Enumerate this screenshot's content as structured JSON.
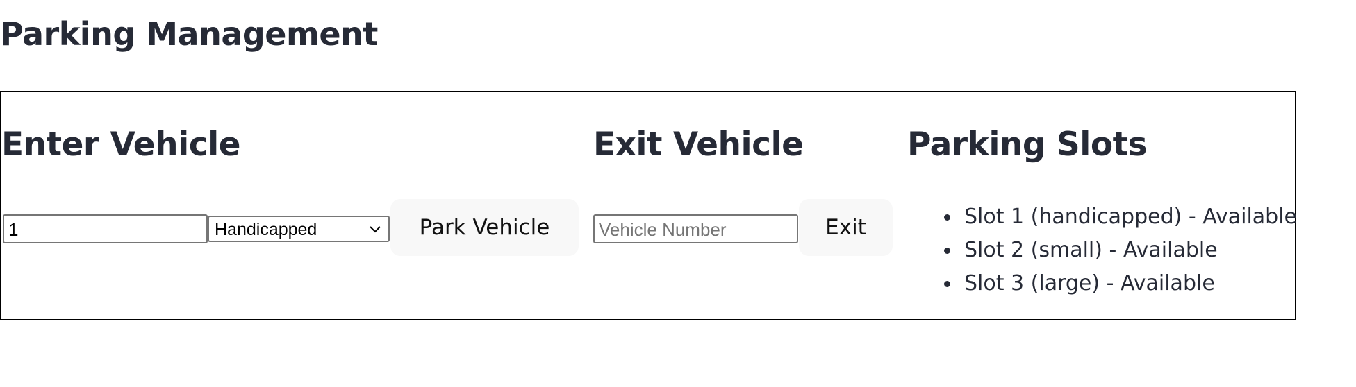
{
  "page": {
    "title": "Parking Management"
  },
  "enter": {
    "heading": "Enter Vehicle",
    "vehicle_input_value": "1",
    "slot_type_selected": "Handicapped",
    "park_button_label": "Park Vehicle"
  },
  "exit": {
    "heading": "Exit Vehicle",
    "vehicle_input_value": "",
    "vehicle_input_placeholder": "Vehicle Number",
    "exit_button_label": "Exit"
  },
  "slots": {
    "heading": "Parking Slots",
    "items": [
      {
        "label": "Slot 1 (handicapped) - Available"
      },
      {
        "label": "Slot 2 (small) - Available"
      },
      {
        "label": "Slot 3 (large) - Available"
      }
    ]
  },
  "icons": {
    "select_chevron": "chevron-down-icon"
  },
  "colors": {
    "text": "#262a36",
    "button_bg": "#f8f8f8",
    "panel_border": "#000000"
  }
}
